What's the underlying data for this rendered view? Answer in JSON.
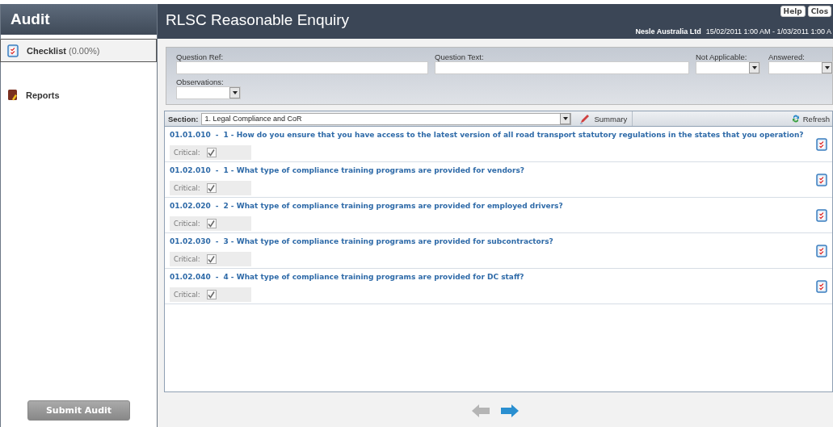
{
  "sidebar": {
    "title": "Audit",
    "items": [
      {
        "label": "Checklist",
        "suffix": "(0.00%)",
        "selected": true
      },
      {
        "label": "Reports",
        "selected": false
      }
    ],
    "submit_button": "Submit Audit"
  },
  "header": {
    "title": "RLSC Reasonable Enquiry",
    "buttons": [
      "Help",
      "Clos"
    ],
    "company": "Nesle Australia Ltd",
    "period": "15/02/2011 1:00 AM  -  1/03/2011 1:00 A"
  },
  "filters": [
    {
      "label": "Question Ref:",
      "kind": "text"
    },
    {
      "label": "Question Text:",
      "kind": "text"
    },
    {
      "label": "Not Applicable:",
      "kind": "select"
    },
    {
      "label": "Answered:",
      "kind": "select"
    },
    {
      "label": "Observations:",
      "kind": "select"
    }
  ],
  "section": {
    "label": "Section:",
    "value": "1. Legal Compliance and CoR",
    "summary": "Summary",
    "refresh": "Refresh"
  },
  "questions": [
    {
      "ref": "01.01.010",
      "separator": "-",
      "text": "1 - How do you ensure that you have access to the latest version of all road transport statutory regulations in the states that you operation?",
      "critical_label": "Critical:",
      "critical": true
    },
    {
      "ref": "01.02.010",
      "separator": "-",
      "text": "1 - What type of compliance training programs are provided for vendors?",
      "critical_label": "Critical:",
      "critical": true
    },
    {
      "ref": "01.02.020",
      "separator": "-",
      "text": "2 - What type of compliance training programs are provided for employed drivers?",
      "critical_label": "Critical:",
      "critical": true
    },
    {
      "ref": "01.02.030",
      "separator": "-",
      "text": "3 - What type of compliance training programs are provided for subcontractors?",
      "critical_label": "Critical:",
      "critical": true
    },
    {
      "ref": "01.02.040",
      "separator": "-",
      "text": "4 - What type of compliance training programs are provided for DC staff?",
      "critical_label": "Critical:",
      "critical": true
    }
  ],
  "nav": {
    "prev_disabled": true,
    "next_disabled": false
  }
}
